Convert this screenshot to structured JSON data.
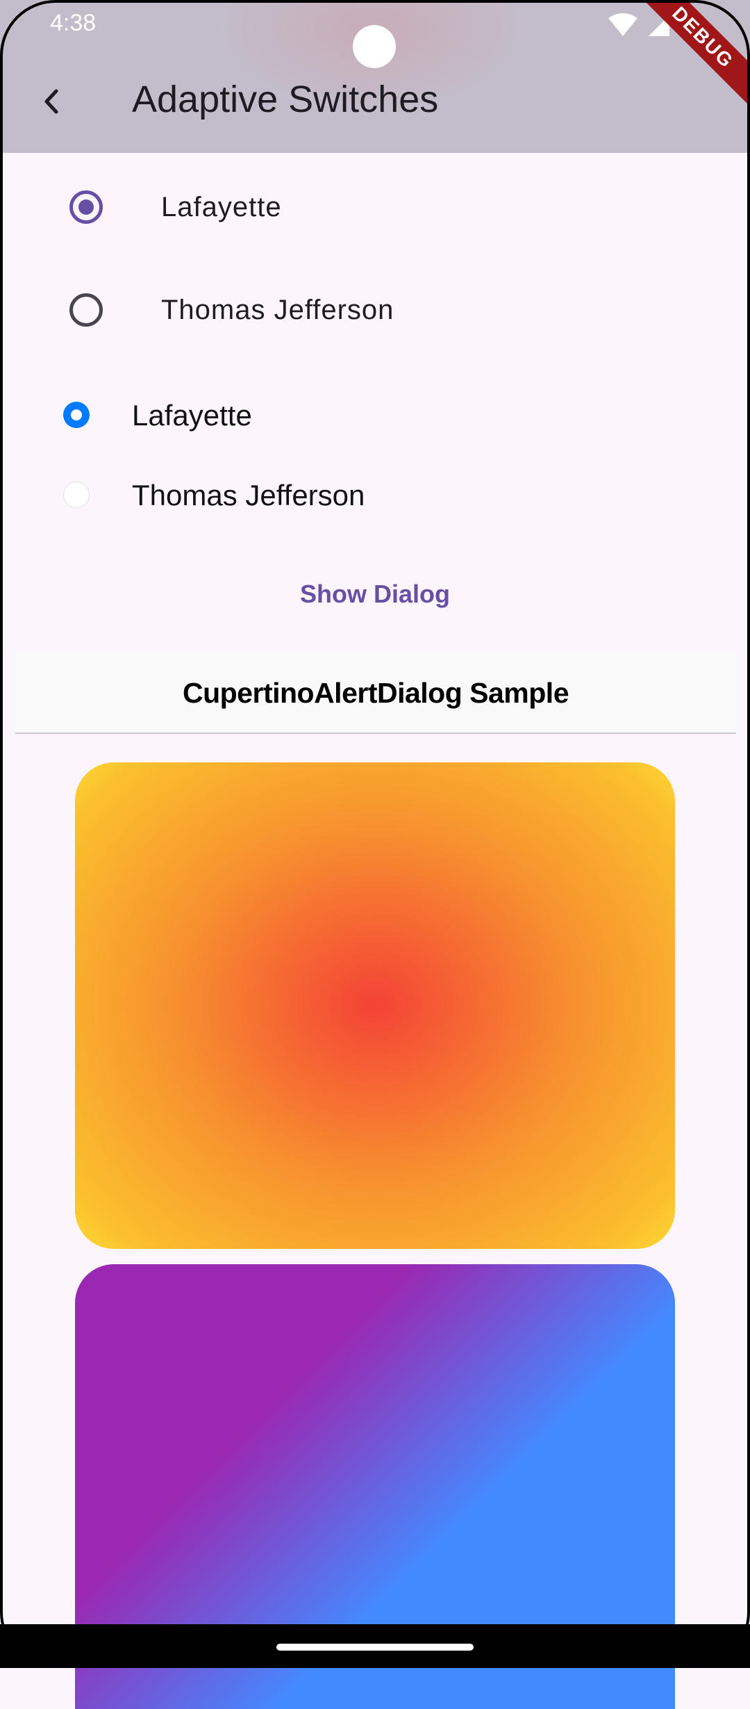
{
  "status_bar": {
    "time": "4:38",
    "debug_label": "DEBUG"
  },
  "app_bar": {
    "title": "Adaptive Switches",
    "back_icon": "chevron-left-icon"
  },
  "material_radios": [
    {
      "label": "Lafayette",
      "selected": true
    },
    {
      "label": "Thomas Jefferson",
      "selected": false
    }
  ],
  "cupertino_radios": [
    {
      "label": "Lafayette",
      "selected": true
    },
    {
      "label": "Thomas Jefferson",
      "selected": false
    }
  ],
  "show_dialog_button": "Show Dialog",
  "cupertino_nav": {
    "title": "CupertinoAlertDialog Sample"
  },
  "colors": {
    "material_accent": "#6750a4",
    "cupertino_accent": "#007aff",
    "background": "#fcf5fb"
  }
}
